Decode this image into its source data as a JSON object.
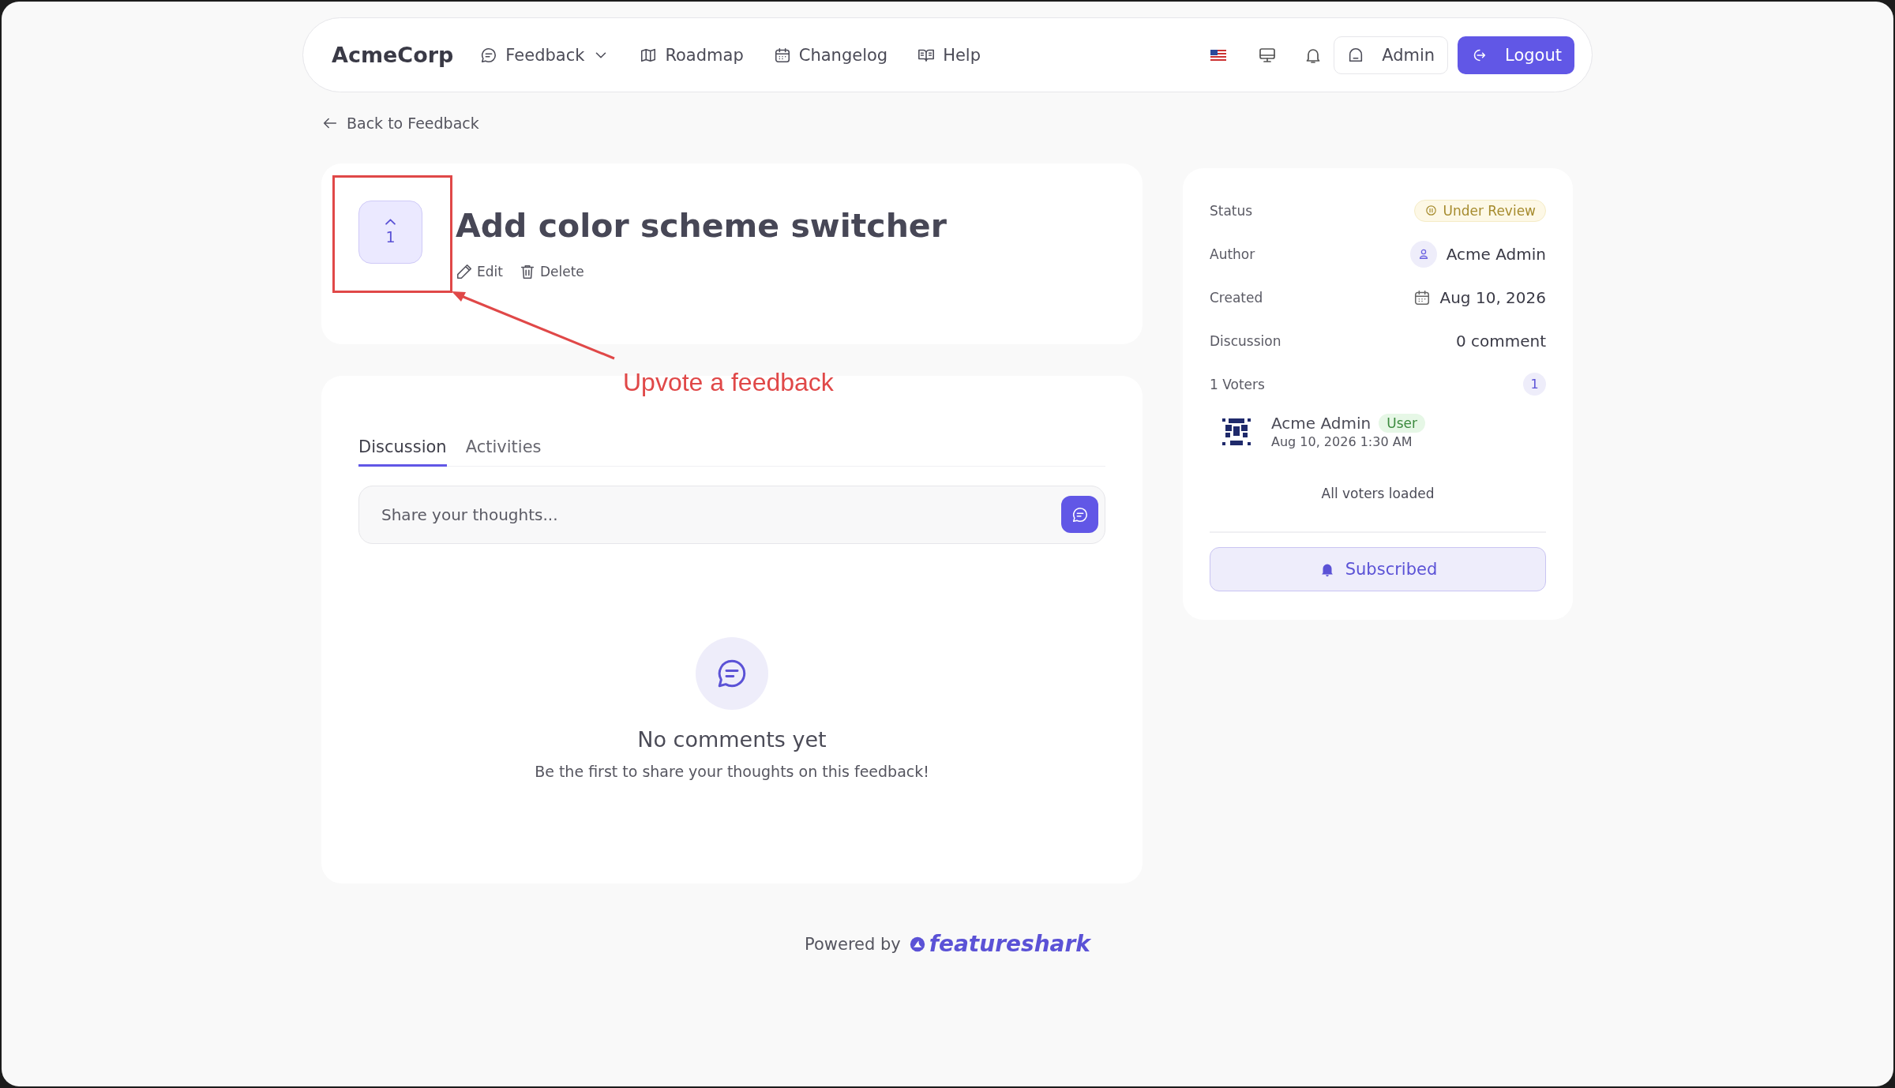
{
  "brand": "AcmeCorp",
  "nav": [
    {
      "label": "Feedback",
      "dropdown": true
    },
    {
      "label": "Roadmap",
      "dropdown": false
    },
    {
      "label": "Changelog",
      "dropdown": false
    },
    {
      "label": "Help",
      "dropdown": false
    }
  ],
  "account": {
    "user": "Admin",
    "logout": "Logout"
  },
  "back_link": "Back to Feedback",
  "feedback": {
    "title": "Add color scheme switcher",
    "votes": "1",
    "actions": [
      {
        "kind": "edit",
        "label": "Edit"
      },
      {
        "kind": "delete",
        "label": "Delete"
      }
    ]
  },
  "annotation": {
    "label": "Upvote a feedback"
  },
  "tabs": [
    {
      "label": "Discussion",
      "selected": true
    },
    {
      "label": "Activities",
      "selected": false
    }
  ],
  "comment_field": {
    "placeholder": "Share your thoughts..."
  },
  "empty_state": {
    "title": "No comments yet",
    "message": "Be the first to share your thoughts on this feedback!"
  },
  "details": [
    {
      "kind": "status",
      "label": "Status",
      "value": "Under Review"
    },
    {
      "kind": "author",
      "label": "Author",
      "value": "Acme Admin"
    },
    {
      "kind": "date",
      "label": "Created",
      "value": "Aug 10, 2026"
    },
    {
      "kind": "text",
      "label": "Discussion",
      "value": "0 comment"
    }
  ],
  "voters": {
    "label": "1 Voters",
    "count": "1",
    "items": [
      {
        "name": "Acme Admin",
        "role": "User",
        "time": "Aug 10, 2026 1:30 AM"
      }
    ],
    "footer": "All voters loaded"
  },
  "subscribe": {
    "label": "Subscribed",
    "subscribed": true
  },
  "footer": {
    "prefix": "Powered by",
    "brand": "featureshark"
  }
}
